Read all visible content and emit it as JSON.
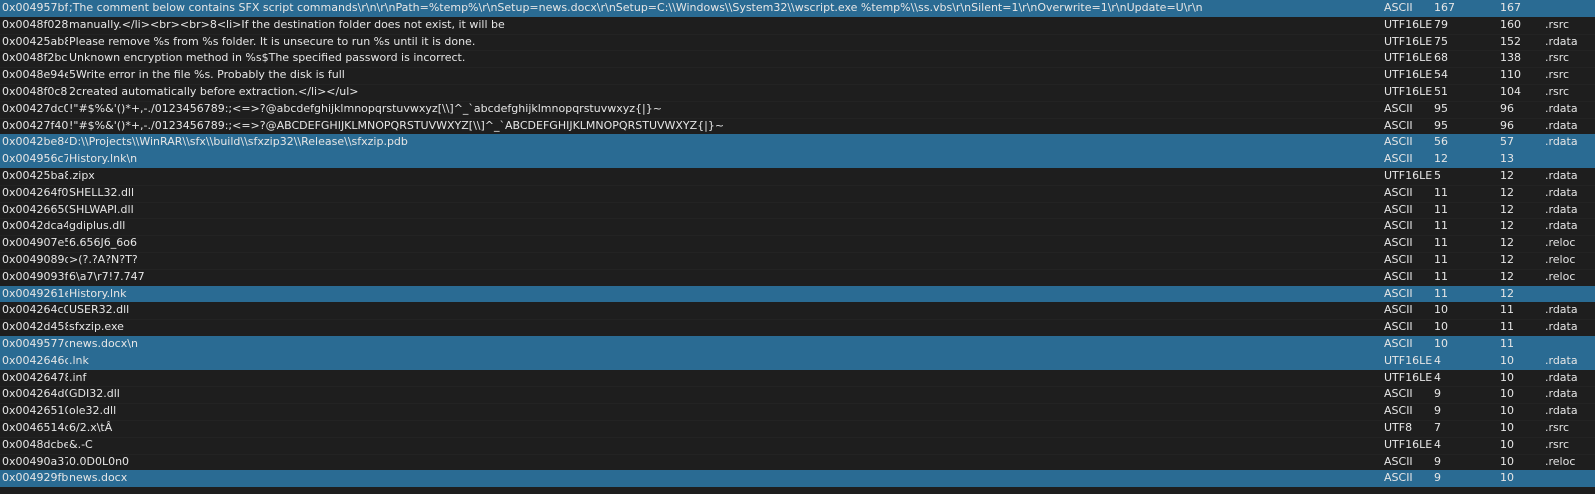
{
  "rows": [
    {
      "address": "0x004957bf",
      "string": ";The comment below contains SFX script commands\\r\\n\\r\\nPath=%temp%\\r\\nSetup=news.docx\\r\\nSetup=C:\\\\Windows\\\\System32\\\\wscript.exe %temp%\\\\ss.vbs\\r\\nSilent=1\\r\\nOverwrite=1\\r\\nUpdate=U\\r\\n",
      "encoding": "ASCII",
      "length": "167",
      "size": "167",
      "section": "",
      "highlighted": true
    },
    {
      "address": "0x0048f028",
      "string": "manually.</li><br><br>8<li>If the destination folder does not exist, it will be",
      "encoding": "UTF16LE",
      "length": "79",
      "size": "160",
      "section": ".rsrc",
      "highlighted": false
    },
    {
      "address": "0x00425ab8",
      "string": "Please remove %s from %s folder. It is unsecure to run %s until it is done.",
      "encoding": "UTF16LE",
      "length": "75",
      "size": "152",
      "section": ".rdata",
      "highlighted": false
    },
    {
      "address": "0x0048f2bc",
      "string": "Unknown encryption method in %s$The specified password is incorrect.",
      "encoding": "UTF16LE",
      "length": "68",
      "size": "138",
      "section": ".rsrc",
      "highlighted": false
    },
    {
      "address": "0x0048e94e",
      "string": "5Write error in the file %s. Probably the disk is full",
      "encoding": "UTF16LE",
      "length": "54",
      "size": "110",
      "section": ".rsrc",
      "highlighted": false
    },
    {
      "address": "0x0048f0c8",
      "string": "2created automatically before extraction.</li></ul>",
      "encoding": "UTF16LE",
      "length": "51",
      "size": "104",
      "section": ".rsrc",
      "highlighted": false
    },
    {
      "address": "0x00427dc0",
      "string": " !\"#$%&'()*+,-./0123456789:;<=>?@abcdefghijklmnopqrstuvwxyz[\\\\]^_`abcdefghijklmnopqrstuvwxyz{|}~",
      "encoding": "ASCII",
      "length": "95",
      "size": "96",
      "section": ".rdata",
      "highlighted": false
    },
    {
      "address": "0x00427f40",
      "string": " !\"#$%&'()*+,-./0123456789:;<=>?@ABCDEFGHIJKLMNOPQRSTUVWXYZ[\\\\]^_`ABCDEFGHIJKLMNOPQRSTUVWXYZ{|}~",
      "encoding": "ASCII",
      "length": "95",
      "size": "96",
      "section": ".rdata",
      "highlighted": false
    },
    {
      "address": "0x0042be84",
      "string": "D:\\\\Projects\\\\WinRAR\\\\sfx\\\\build\\\\sfxzip32\\\\Release\\\\sfxzip.pdb",
      "encoding": "ASCII",
      "length": "56",
      "size": "57",
      "section": ".rdata",
      "highlighted": true
    },
    {
      "address": "0x004956c7",
      "string": "History.lnk\\n",
      "encoding": "ASCII",
      "length": "12",
      "size": "13",
      "section": "",
      "highlighted": true
    },
    {
      "address": "0x00425ba8",
      "string": ".zipx",
      "encoding": "UTF16LE",
      "length": "5",
      "size": "12",
      "section": ".rdata",
      "highlighted": false
    },
    {
      "address": "0x004264f0",
      "string": "SHELL32.dll",
      "encoding": "ASCII",
      "length": "11",
      "size": "12",
      "section": ".rdata",
      "highlighted": false
    },
    {
      "address": "0x00426650",
      "string": "SHLWAPI.dll",
      "encoding": "ASCII",
      "length": "11",
      "size": "12",
      "section": ".rdata",
      "highlighted": false
    },
    {
      "address": "0x0042dca4",
      "string": "gdiplus.dll",
      "encoding": "ASCII",
      "length": "11",
      "size": "12",
      "section": ".rdata",
      "highlighted": false
    },
    {
      "address": "0x004907e5",
      "string": "6.656J6_6o6",
      "encoding": "ASCII",
      "length": "11",
      "size": "12",
      "section": ".reloc",
      "highlighted": false
    },
    {
      "address": "0x0049089d",
      "string": ">(?.?A?N?T?",
      "encoding": "ASCII",
      "length": "11",
      "size": "12",
      "section": ".reloc",
      "highlighted": false
    },
    {
      "address": "0x0049093f",
      "string": "6\\a7\\r7!7.747",
      "encoding": "ASCII",
      "length": "11",
      "size": "12",
      "section": ".reloc",
      "highlighted": false
    },
    {
      "address": "0x0049261e",
      "string": "History.lnk",
      "encoding": "ASCII",
      "length": "11",
      "size": "12",
      "section": "",
      "highlighted": true
    },
    {
      "address": "0x004264c0",
      "string": "USER32.dll",
      "encoding": "ASCII",
      "length": "10",
      "size": "11",
      "section": ".rdata",
      "highlighted": false
    },
    {
      "address": "0x0042d458",
      "string": "sfxzip.exe",
      "encoding": "ASCII",
      "length": "10",
      "size": "11",
      "section": ".rdata",
      "highlighted": false
    },
    {
      "address": "0x0049577c",
      "string": "news.docx\\n",
      "encoding": "ASCII",
      "length": "10",
      "size": "11",
      "section": "",
      "highlighted": true
    },
    {
      "address": "0x0042646c",
      "string": ".lnk",
      "encoding": "UTF16LE",
      "length": "4",
      "size": "10",
      "section": ".rdata",
      "highlighted": true
    },
    {
      "address": "0x00426478",
      "string": ".inf",
      "encoding": "UTF16LE",
      "length": "4",
      "size": "10",
      "section": ".rdata",
      "highlighted": false
    },
    {
      "address": "0x004264d0",
      "string": "GDI32.dll",
      "encoding": "ASCII",
      "length": "9",
      "size": "10",
      "section": ".rdata",
      "highlighted": false
    },
    {
      "address": "0x00426510",
      "string": "ole32.dll",
      "encoding": "ASCII",
      "length": "9",
      "size": "10",
      "section": ".rdata",
      "highlighted": false
    },
    {
      "address": "0x0046514d",
      "string": "6/2.x\\tÂ",
      "encoding": "UTF8",
      "length": "7",
      "size": "10",
      "section": ".rsrc",
      "highlighted": false
    },
    {
      "address": "0x0048dcbe",
      "string": "&.-C",
      "encoding": "UTF16LE",
      "length": "4",
      "size": "10",
      "section": ".rsrc",
      "highlighted": false
    },
    {
      "address": "0x00490a37",
      "string": "0.0D0L0n0",
      "encoding": "ASCII",
      "length": "9",
      "size": "10",
      "section": ".reloc",
      "highlighted": false
    },
    {
      "address": "0x004929fb",
      "string": "news.docx",
      "encoding": "ASCII",
      "length": "9",
      "size": "10",
      "section": "",
      "highlighted": true
    }
  ],
  "colors": {
    "background": "#1e1e1e",
    "highlight": "#2a6b93",
    "text": "#e6e6e6"
  }
}
